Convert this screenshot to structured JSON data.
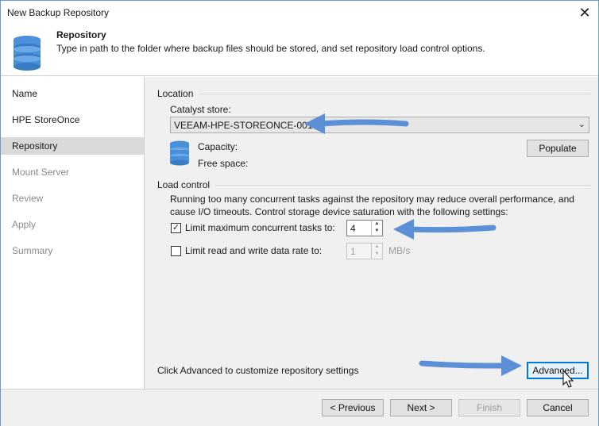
{
  "window": {
    "title": "New Backup Repository"
  },
  "header": {
    "title": "Repository",
    "subtitle": "Type in path to the folder where backup files should be stored, and set repository load control options."
  },
  "sidebar": {
    "items": [
      {
        "label": "Name",
        "state": "done"
      },
      {
        "label": "HPE StoreOnce",
        "state": "done"
      },
      {
        "label": "Repository",
        "state": "active"
      },
      {
        "label": "Mount Server",
        "state": "pending"
      },
      {
        "label": "Review",
        "state": "pending"
      },
      {
        "label": "Apply",
        "state": "pending"
      },
      {
        "label": "Summary",
        "state": "pending"
      }
    ]
  },
  "location": {
    "section_label": "Location",
    "store_label": "Catalyst store:",
    "store_value": "VEEAM-HPE-STOREONCE-001",
    "capacity_label": "Capacity:",
    "free_space_label": "Free space:",
    "populate_label": "Populate"
  },
  "load_control": {
    "section_label": "Load control",
    "description_line1": "Running too many concurrent tasks against the repository may reduce overall performance, and",
    "description_line2": "cause I/O timeouts. Control storage device saturation with the following settings:",
    "limit_tasks_label": "Limit maximum concurrent tasks to:",
    "limit_tasks_checked": true,
    "limit_tasks_value": "4",
    "limit_rate_label": "Limit read and write data rate to:",
    "limit_rate_checked": false,
    "limit_rate_value": "1",
    "limit_rate_unit": "MB/s"
  },
  "advanced": {
    "hint": "Click Advanced to customize repository settings",
    "button_label": "Advanced..."
  },
  "footer": {
    "previous_label": "< Previous",
    "next_label": "Next >",
    "finish_label": "Finish",
    "cancel_label": "Cancel"
  },
  "colors": {
    "annotation_arrow": "#5b8fd6",
    "focus_border": "#0078d7",
    "active_nav_bg": "#d9d9d9",
    "content_bg": "#f0f0f0"
  }
}
